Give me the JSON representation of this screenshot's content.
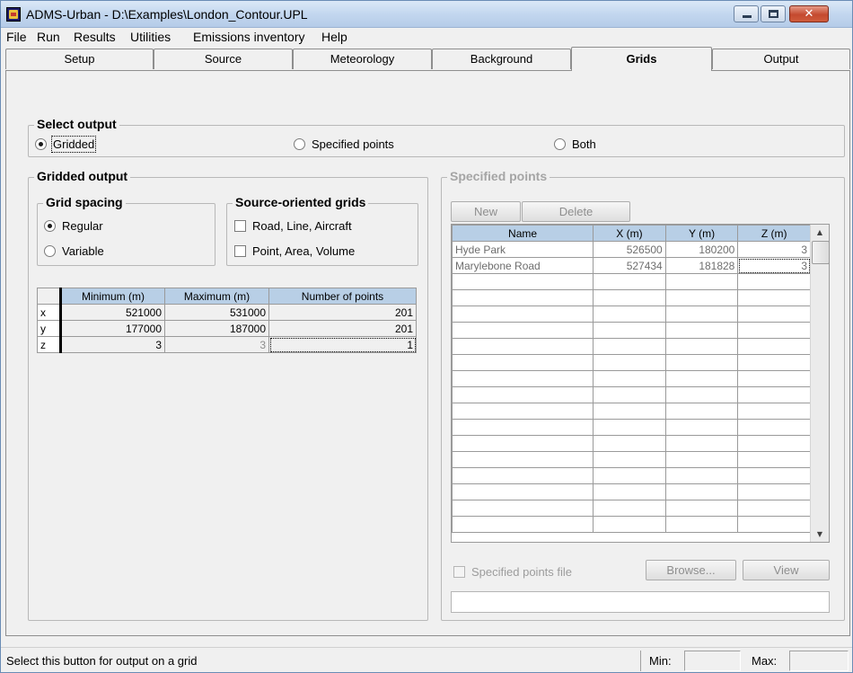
{
  "window": {
    "title": "ADMS-Urban - D:\\Examples\\London_Contour.UPL",
    "close_glyph": "✕"
  },
  "menu": [
    "File",
    "Run",
    "Results",
    "Utilities",
    "Emissions inventory",
    "Help"
  ],
  "tabs": [
    {
      "label": "Setup",
      "active": false
    },
    {
      "label": "Source",
      "active": false
    },
    {
      "label": "Meteorology",
      "active": false
    },
    {
      "label": "Background",
      "active": false
    },
    {
      "label": "Grids",
      "active": true
    },
    {
      "label": "Output",
      "active": false
    }
  ],
  "select_output": {
    "label": "Select output",
    "options": [
      {
        "label": "Gridded",
        "selected": true
      },
      {
        "label": "Specified points",
        "selected": false
      },
      {
        "label": "Both",
        "selected": false
      }
    ]
  },
  "gridded_output": {
    "label": "Gridded output",
    "grid_spacing": {
      "label": "Grid spacing",
      "options": [
        {
          "label": "Regular",
          "selected": true
        },
        {
          "label": "Variable",
          "selected": false
        }
      ]
    },
    "source_oriented": {
      "label": "Source-oriented grids",
      "options": [
        {
          "label": "Road, Line, Aircraft",
          "checked": false
        },
        {
          "label": "Point, Area, Volume",
          "checked": false
        }
      ]
    },
    "table": {
      "columns": [
        "Minimum (m)",
        "Maximum (m)",
        "Number of points"
      ],
      "rows": [
        {
          "axis": "x",
          "min": "521000",
          "max": "531000",
          "points": "201"
        },
        {
          "axis": "y",
          "min": "177000",
          "max": "187000",
          "points": "201"
        },
        {
          "axis": "z",
          "min": "3",
          "max": "3",
          "points": "1"
        }
      ]
    }
  },
  "specified_points": {
    "label": "Specified points",
    "new_label": "New",
    "delete_label": "Delete",
    "columns": [
      "Name",
      "X (m)",
      "Y (m)",
      "Z (m)"
    ],
    "rows": [
      {
        "name": "Hyde Park",
        "x": "526500",
        "y": "180200",
        "z": "3"
      },
      {
        "name": "Marylebone Road",
        "x": "527434",
        "y": "181828",
        "z": "3"
      }
    ],
    "file_label": "Specified points file",
    "browse_label": "Browse...",
    "view_label": "View",
    "file_path": ""
  },
  "status": {
    "message": "Select this button for output on a grid",
    "min_label": "Min:",
    "max_label": "Max:",
    "min_value": "",
    "max_value": ""
  }
}
